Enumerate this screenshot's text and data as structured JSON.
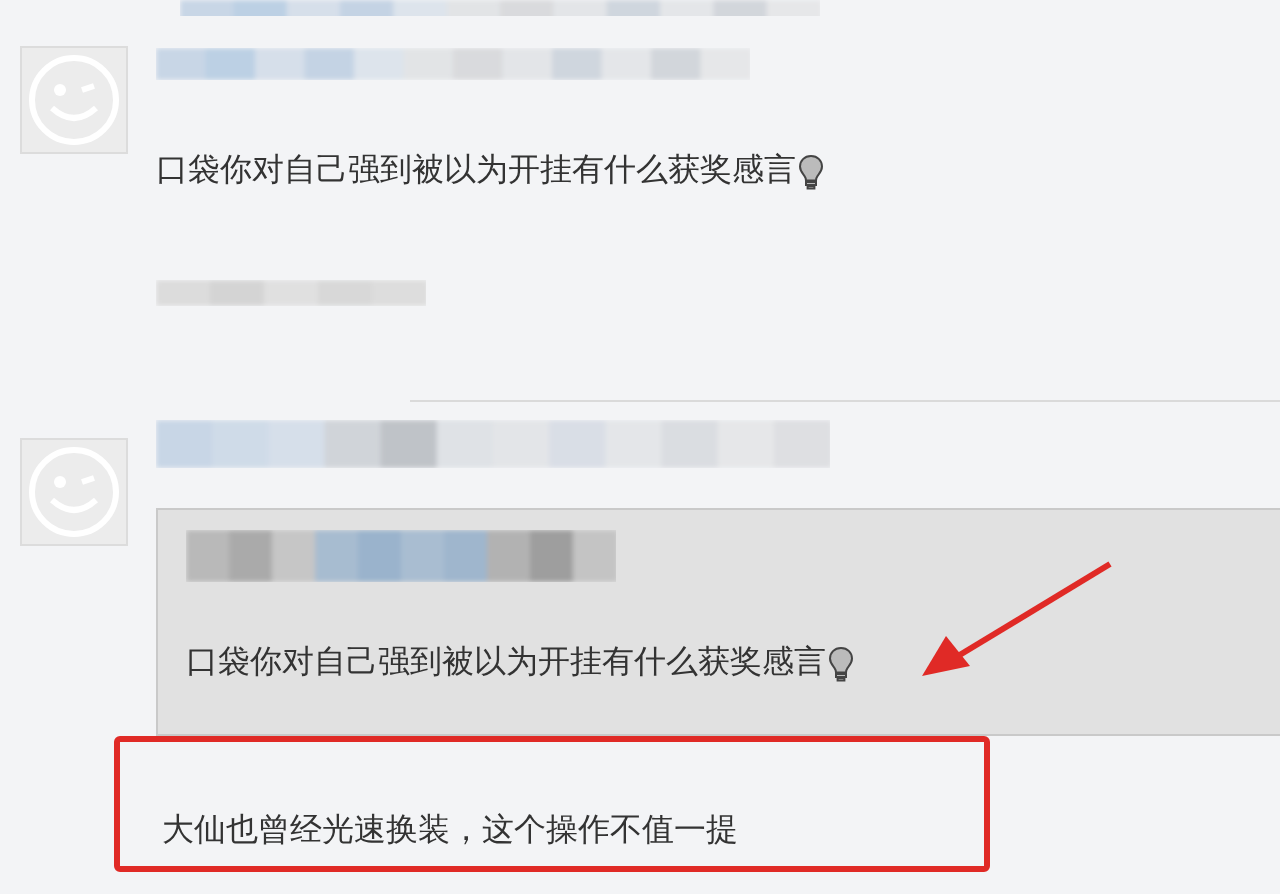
{
  "comments": [
    {
      "kind": "plain",
      "text": "口袋你对自己强到被以为开挂有什么获奖感言"
    },
    {
      "kind": "reply",
      "quote": {
        "text": "口袋你对自己强到被以为开挂有什么获奖感言"
      },
      "text": "大仙也曾经光速换装，这个操作不值一提",
      "highlighted": true
    }
  ]
}
